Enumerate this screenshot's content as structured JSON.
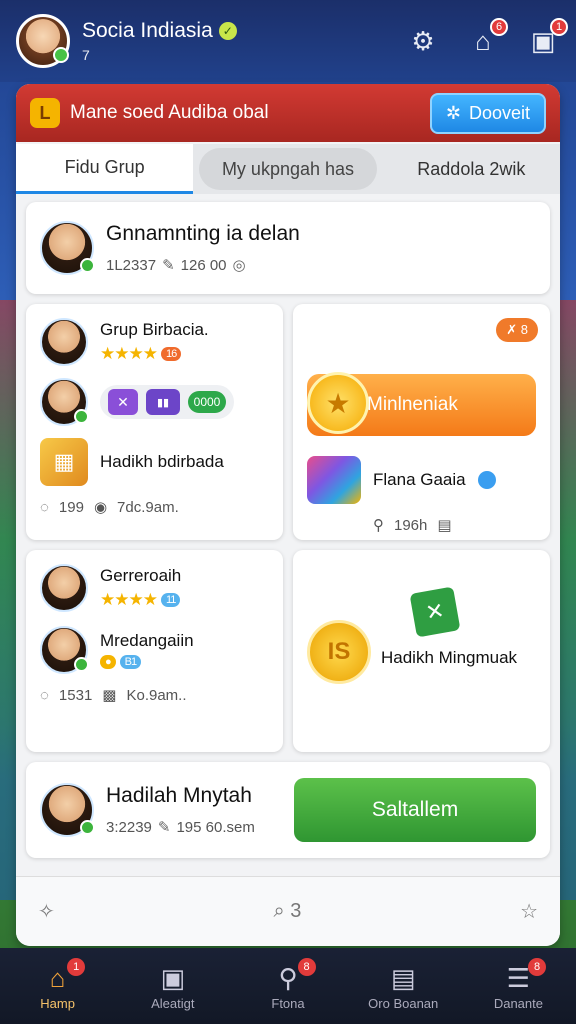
{
  "header": {
    "user_name": "Socia Indiasia",
    "user_sub": "7",
    "icons": [
      "settings-icon",
      "home-icon",
      "inbox-icon"
    ],
    "badges": [
      "6",
      "1"
    ]
  },
  "panel": {
    "title": "Mane soed Audiba obal",
    "deposit_label": "Dooveit",
    "tabs": [
      "Fidu Grup",
      "My ukpngah has",
      "Raddola 2wik"
    ]
  },
  "card1": {
    "title": "Gnnamnting ia delan",
    "meta_a": "1L2337",
    "meta_b": "126 00"
  },
  "card2": {
    "group_title": "Grup Birbacia.",
    "level": "16",
    "badge_small": "0000",
    "gift_title": "Hadikh bdirbada",
    "meta_a": "199",
    "meta_b": "7dc.9am."
  },
  "card3": {
    "tag": "8",
    "button_label": "Minlneniak",
    "lower_title": "Flana Gaaia",
    "meta": "196h"
  },
  "card4": {
    "title": "Gerreroaih",
    "level": "11",
    "second_title": "Mredangaiin",
    "tiny_pill": "B1",
    "meta_a": "1531",
    "meta_b": "Ko.9am.."
  },
  "card5": {
    "coin": "IS",
    "label": "Hadikh Mingmuak"
  },
  "card6": {
    "title": "Hadilah Mnytah",
    "meta_a": "3:2239",
    "meta_b": "195 60.sem",
    "button_label": "Saltallem"
  },
  "panel_footer": {
    "count": "3"
  },
  "bottom_nav": [
    {
      "label": "Hamp",
      "badge": "1"
    },
    {
      "label": "Aleatigt",
      "badge": ""
    },
    {
      "label": "Ftona",
      "badge": "8"
    },
    {
      "label": "Oro Boanan",
      "badge": ""
    },
    {
      "label": "Danante",
      "badge": "8"
    }
  ]
}
